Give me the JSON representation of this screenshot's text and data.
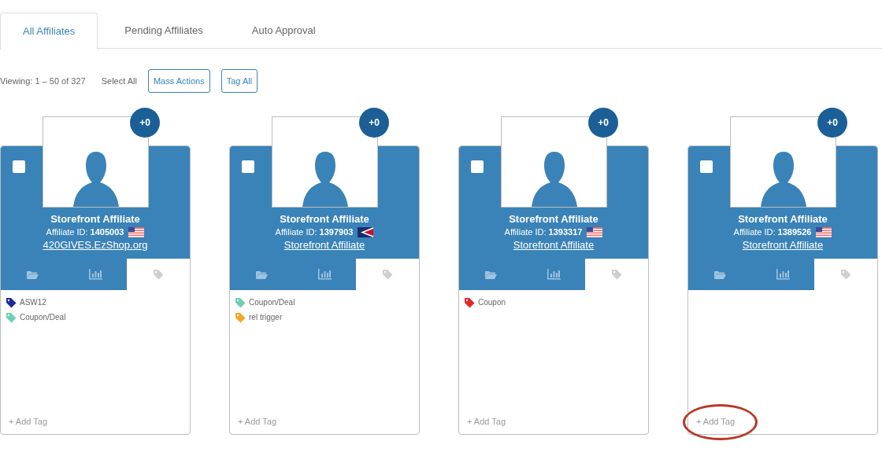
{
  "tabs": [
    {
      "label": "All Affiliates",
      "selected": true
    },
    {
      "label": "Pending Affiliates",
      "selected": false
    },
    {
      "label": "Auto Approval",
      "selected": false
    }
  ],
  "toolbar": {
    "viewing": "Viewing: 1 – 50 of 327",
    "select_all": "Select All",
    "buttons": [
      "Mass Actions",
      "Tag All"
    ]
  },
  "cards": [
    {
      "badge": "+0",
      "checked": false,
      "name": "Storefront Affiliate",
      "id_label": "Affiliate ID:",
      "id": "1405003",
      "flag": {
        "kind": "us"
      },
      "link": "420GIVES.EzShop.org",
      "panel_tabs": [
        {
          "kind": "folder",
          "selected": false
        },
        {
          "kind": "chart",
          "selected": false
        },
        {
          "kind": "tag",
          "selected": true
        }
      ],
      "tags": [
        {
          "label": "ASW12",
          "color": "#1a2a9c"
        },
        {
          "label": "Coupon/Deal",
          "color": "#6fcfb4"
        }
      ],
      "add_tag": "+ Add Tag",
      "highlighted": false
    },
    {
      "badge": "+0",
      "checked": false,
      "name": "Storefront Affiliate",
      "id_label": "Affiliate ID:",
      "id": "1397903",
      "flag": {
        "kind": "as"
      },
      "link": "Storefront Affiliate",
      "panel_tabs": [
        {
          "kind": "folder",
          "selected": false
        },
        {
          "kind": "chart",
          "selected": false
        },
        {
          "kind": "tag",
          "selected": true
        }
      ],
      "tags": [
        {
          "label": "Coupon/Deal",
          "color": "#6fcfb4"
        },
        {
          "label": "rel trigger",
          "color": "#f5a623"
        }
      ],
      "add_tag": "+ Add Tag",
      "highlighted": false
    },
    {
      "badge": "+0",
      "checked": false,
      "name": "Storefront Affiliate",
      "id_label": "Affiliate ID:",
      "id": "1393317",
      "flag": {
        "kind": "us"
      },
      "link": "Storefront Affiliate",
      "panel_tabs": [
        {
          "kind": "folder",
          "selected": false
        },
        {
          "kind": "chart",
          "selected": false
        },
        {
          "kind": "tag",
          "selected": true
        }
      ],
      "tags": [
        {
          "label": "Coupon",
          "color": "#e02828"
        }
      ],
      "add_tag": "+ Add Tag",
      "highlighted": false
    },
    {
      "badge": "+0",
      "checked": false,
      "name": "Storefront Affiliate",
      "id_label": "Affiliate ID:",
      "id": "1389526",
      "flag": {
        "kind": "us"
      },
      "link": "Storefront Affiliate",
      "panel_tabs": [
        {
          "kind": "folder",
          "selected": false
        },
        {
          "kind": "chart",
          "selected": false
        },
        {
          "kind": "tag",
          "selected": true
        }
      ],
      "add_tag": "+ Add Tag",
      "highlighted": true
    }
  ]
}
